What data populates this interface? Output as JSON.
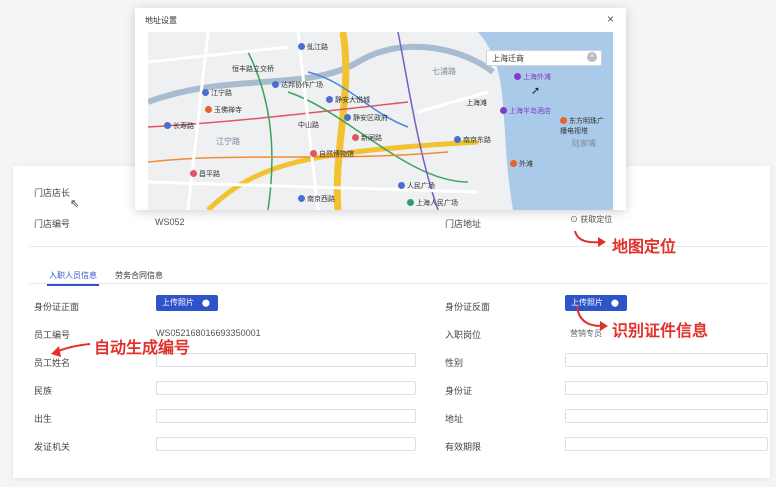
{
  "modal": {
    "title": "地址设置",
    "close": "×",
    "search_value": "上海迁商",
    "map_pois": [
      "恒丰路立交桥",
      "达邦协作广场",
      "江宁路",
      "玉佛禅寺",
      "静安大悦城",
      "长寿路",
      "静安区政府",
      "江宁路",
      "自然博物馆",
      "新闸路",
      "南京东路",
      "昌平路",
      "人民广场",
      "上海人民广场",
      "南京西路",
      "外滩",
      "七浦路",
      "上海外滩",
      "上海半岛酒店",
      "东方明珠广播电视塔",
      "陆家嘴",
      "上海滩",
      "中山路",
      "虬江路"
    ]
  },
  "store": {
    "manager_label": "门店店长",
    "number_label": "门店编号",
    "number_value": "WS052",
    "address_label": "门店地址",
    "locate_button": "获取定位"
  },
  "tabs": [
    {
      "label": "入职人员信息"
    },
    {
      "label": "劳务合同信息"
    }
  ],
  "form": {
    "id_front_label": "身份证正面",
    "id_back_label": "身份证反面",
    "upload_label": "上传照片",
    "employee_no_label": "员工编号",
    "employee_no_value": "WS052168016693350001",
    "position_label": "入职岗位",
    "position_value": "营销专员",
    "name_label": "员工姓名",
    "gender_label": "性别",
    "ethnicity_label": "民族",
    "id_number_label": "身份证",
    "birth_label": "出生",
    "address_label": "地址",
    "issuer_label": "发证机关",
    "validity_label": "有效期限"
  },
  "annotations": {
    "map_locate": "地图定位",
    "recognize_id": "识别证件信息",
    "auto_number": "自动生成编号"
  },
  "colors": {
    "primary": "#2f54c8",
    "annotation": "#e0322b"
  }
}
